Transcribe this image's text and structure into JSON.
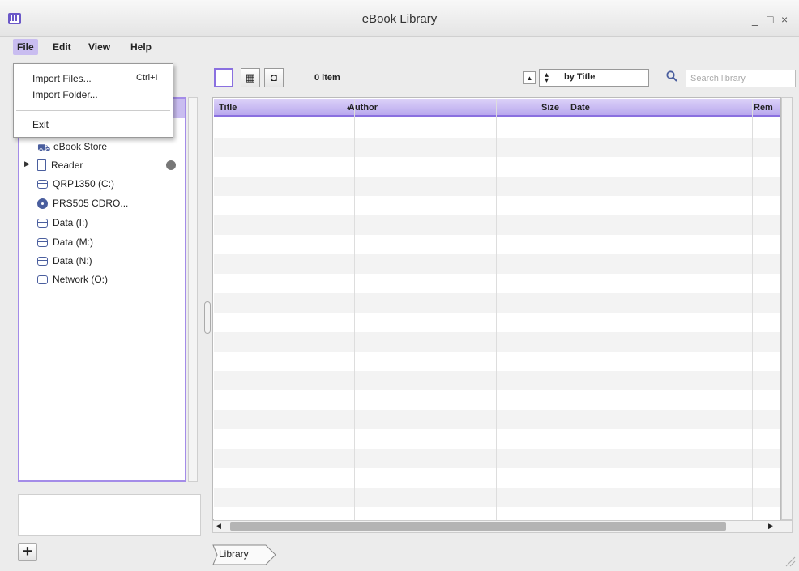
{
  "window": {
    "title": "eBook Library",
    "minimize": "_",
    "maximize": "□",
    "close": "×"
  },
  "menubar": {
    "items": [
      "File",
      "Edit",
      "View",
      "Help"
    ]
  },
  "file_menu": {
    "import_files": "Import Files...",
    "import_files_shortcut": "Ctrl+I",
    "import_folder": "Import Folder...",
    "exit": "Exit"
  },
  "sidebar": {
    "items": [
      {
        "label": "eBook Store",
        "icon": "store-icon"
      },
      {
        "label": "Reader",
        "icon": "reader-icon"
      },
      {
        "label": "QRP1350 (C:)",
        "icon": "drive-icon"
      },
      {
        "label": "PRS505 CDRO...",
        "icon": "cd-icon"
      },
      {
        "label": "Data (I:)",
        "icon": "drive-icon"
      },
      {
        "label": "Data (M:)",
        "icon": "drive-icon"
      },
      {
        "label": "Data (N:)",
        "icon": "drive-icon"
      },
      {
        "label": "Network (O:)",
        "icon": "drive-icon"
      }
    ],
    "add_button": "+"
  },
  "toolbar": {
    "item_count": "0 item",
    "sort_label": "by Title",
    "search_placeholder": "Search library"
  },
  "table": {
    "columns": [
      "Title",
      "Author",
      "Size",
      "Date",
      "Rem"
    ],
    "rows": []
  },
  "tabs": {
    "library": "Library"
  },
  "colors": {
    "accent": "#8a70e0",
    "selection": "#c9bdf0",
    "header": "#b9a8ee"
  }
}
